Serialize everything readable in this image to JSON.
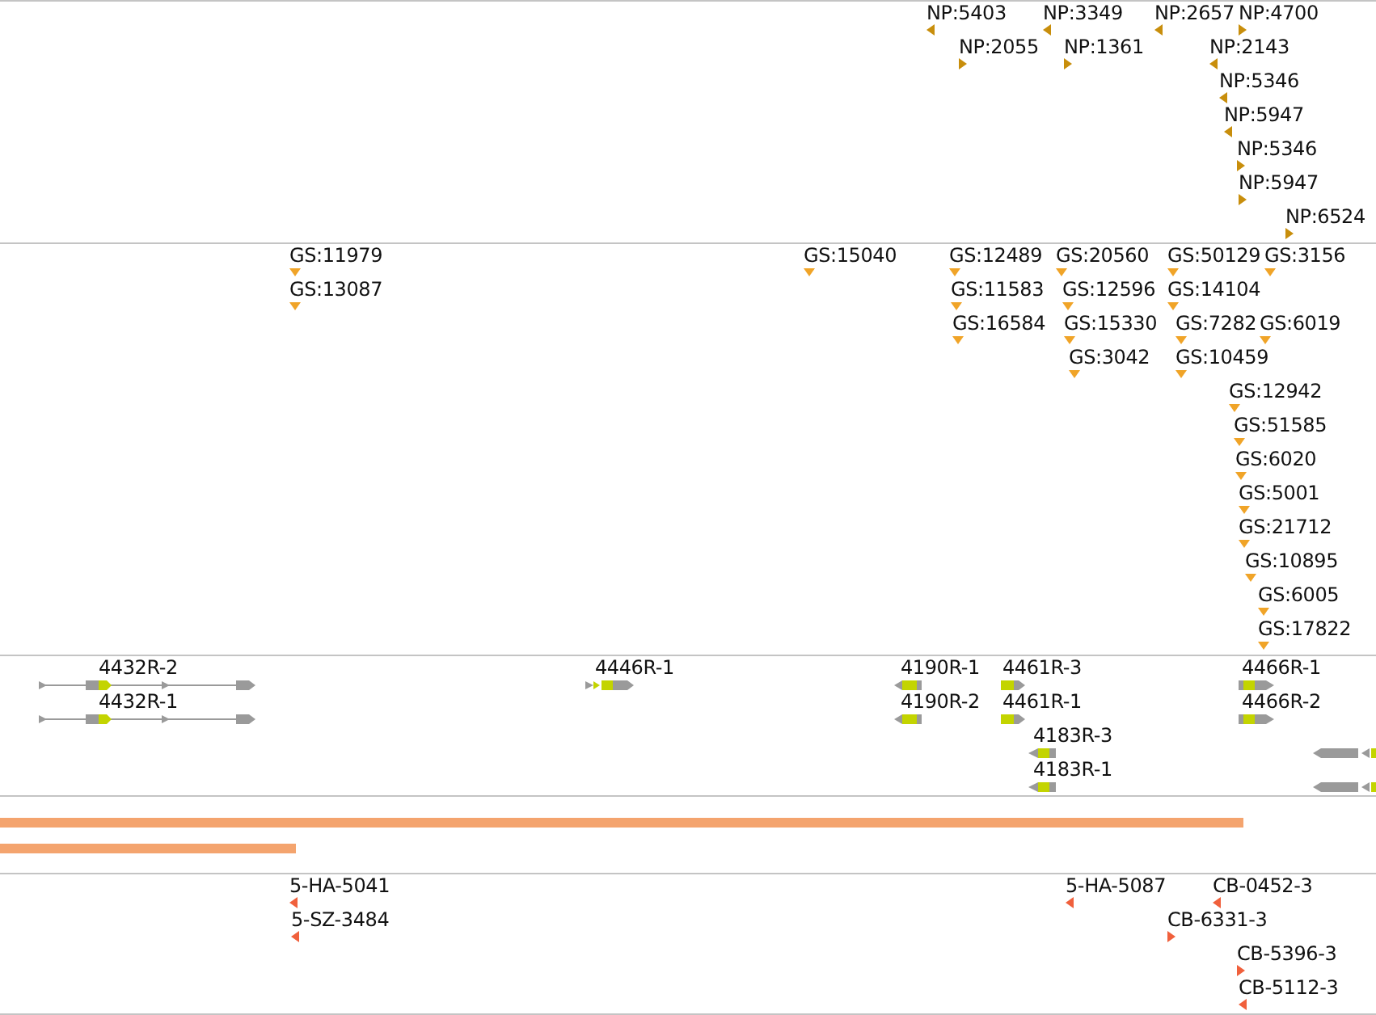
{
  "tracks": [
    {
      "kind": "stranded",
      "color": "#c88e0c",
      "features": [
        {
          "label": "NP:5403",
          "reverse": true
        },
        {
          "label": "NP:3349",
          "reverse": true
        },
        {
          "label": "NP:2657",
          "reverse": true
        },
        {
          "label": "NP:4700",
          "reverse": false
        },
        {
          "label": "NP:2055",
          "reverse": false
        },
        {
          "label": "NP:1361",
          "reverse": false
        },
        {
          "label": "NP:2143",
          "reverse": true
        },
        {
          "label": "NP:5346",
          "reverse": true
        },
        {
          "label": "NP:5947",
          "reverse": true
        },
        {
          "label": "NP:5346",
          "reverse": false
        },
        {
          "label": "NP:5947",
          "reverse": false
        },
        {
          "label": "NP:6524",
          "reverse": false
        }
      ]
    },
    {
      "kind": "points",
      "color": "#f0a428",
      "features": [
        {
          "label": "GS:11979"
        },
        {
          "label": "GS:15040"
        },
        {
          "label": "GS:12489"
        },
        {
          "label": "GS:20560"
        },
        {
          "label": "GS:50129"
        },
        {
          "label": "GS:3156"
        },
        {
          "label": "GS:13087"
        },
        {
          "label": "GS:11583"
        },
        {
          "label": "GS:12596"
        },
        {
          "label": "GS:14104"
        },
        {
          "label": "GS:16584"
        },
        {
          "label": "GS:15330"
        },
        {
          "label": "GS:7282"
        },
        {
          "label": "GS:6019"
        },
        {
          "label": "GS:3042"
        },
        {
          "label": "GS:10459"
        },
        {
          "label": "GS:12942"
        },
        {
          "label": "GS:51585"
        },
        {
          "label": "GS:6020"
        },
        {
          "label": "GS:5001"
        },
        {
          "label": "GS:21712"
        },
        {
          "label": "GS:10895"
        },
        {
          "label": "GS:6005"
        },
        {
          "label": "GS:17822"
        }
      ]
    },
    {
      "kind": "genes",
      "features": [
        {
          "label": "4432R-2",
          "reverse": false
        },
        {
          "label": "4446R-1",
          "reverse": false
        },
        {
          "label": "4190R-1",
          "reverse": true
        },
        {
          "label": "4461R-3",
          "reverse": false
        },
        {
          "label": "4466R-1",
          "reverse": false
        },
        {
          "label": "4432R-1",
          "reverse": false
        },
        {
          "label": "4190R-2",
          "reverse": true
        },
        {
          "label": "4461R-1",
          "reverse": false
        },
        {
          "label": "4466R-2",
          "reverse": false
        },
        {
          "label": "4183R-3",
          "reverse": true
        },
        {
          "reverse": true
        },
        {
          "label": "4183R-1",
          "reverse": true
        },
        {
          "reverse": true
        }
      ]
    },
    {
      "kind": "bars",
      "color": "#f4a46e"
    },
    {
      "kind": "stranded",
      "color": "#f0603c",
      "features": [
        {
          "label": "5-HA-5041",
          "reverse": true
        },
        {
          "label": "5-HA-5087",
          "reverse": true
        },
        {
          "label": "CB-0452-3",
          "reverse": true
        },
        {
          "label": "5-SZ-3484",
          "reverse": true
        },
        {
          "label": "CB-6331-3",
          "reverse": false
        },
        {
          "label": "CB-5396-3",
          "reverse": false
        },
        {
          "label": "CB-5112-3",
          "reverse": true
        }
      ]
    }
  ]
}
